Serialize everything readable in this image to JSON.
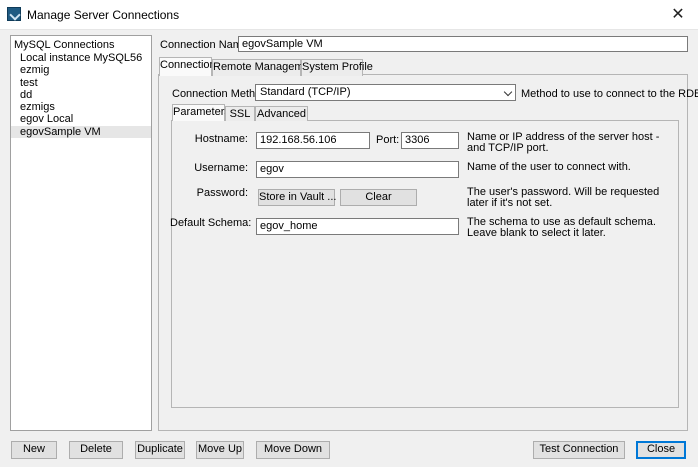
{
  "window": {
    "title": "Manage Server Connections",
    "close_glyph": "✕",
    "icon": "mysql-workbench-icon"
  },
  "connections": {
    "header": "MySQL Connections",
    "items": [
      "Local instance MySQL56",
      "ezmig",
      "test",
      "dd",
      "ezmigs",
      "egov Local",
      "egovSample VM"
    ],
    "selected_index": 6
  },
  "connection_name": {
    "label": "Connection Name:",
    "value": "egovSample VM"
  },
  "tabs": {
    "connection": "Connection",
    "remote": "Remote Management",
    "profile": "System Profile"
  },
  "method": {
    "label": "Connection Method:",
    "value": "Standard (TCP/IP)",
    "hint": "Method to use to connect to the RDBMS"
  },
  "subtabs": {
    "parameters": "Parameters",
    "ssl": "SSL",
    "advanced": "Advanced"
  },
  "params": {
    "hostname_label": "Hostname:",
    "hostname": "192.168.56.106",
    "port_label": "Port:",
    "port": "3306",
    "hostname_hint": "Name or IP address of the server host - and TCP/IP port.",
    "username_label": "Username:",
    "username": "egov",
    "username_hint": "Name of the user to connect with.",
    "password_label": "Password:",
    "store_vault": "Store in Vault ...",
    "clear": "Clear",
    "password_hint": "The user's password. Will be requested later if it's not set.",
    "schema_label": "Default Schema:",
    "schema": "egov_home",
    "schema_hint": "The schema to use as default schema. Leave blank to select it later."
  },
  "buttons": {
    "new": "New",
    "delete": "Delete",
    "duplicate": "Duplicate",
    "move_up": "Move Up",
    "move_down": "Move Down",
    "test": "Test Connection",
    "close": "Close"
  }
}
